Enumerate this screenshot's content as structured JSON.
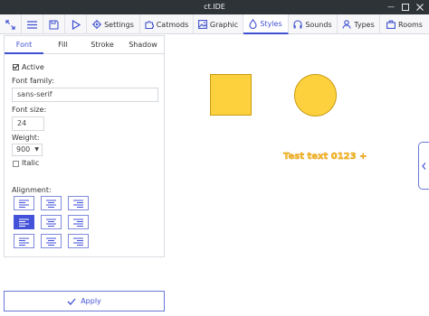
{
  "window": {
    "title": "ct.IDE"
  },
  "toolbar": {
    "tabs": [
      {
        "label": "Settings",
        "icon": "gear-icon"
      },
      {
        "label": "Catmods",
        "icon": "puzzle-icon"
      },
      {
        "label": "Graphic",
        "icon": "image-icon"
      },
      {
        "label": "Styles",
        "icon": "droplet-icon",
        "active": true
      },
      {
        "label": "Sounds",
        "icon": "headphones-icon"
      },
      {
        "label": "Types",
        "icon": "user-icon"
      },
      {
        "label": "Rooms",
        "icon": "briefcase-icon"
      }
    ]
  },
  "style_editor": {
    "subtabs": [
      "Font",
      "Fill",
      "Stroke",
      "Shadow"
    ],
    "active_subtab": "Font",
    "active_label": "Active",
    "active_checked": true,
    "font_family_label": "Font family:",
    "font_family_value": "sans-serif",
    "font_size_label": "Font size:",
    "font_size_value": "24",
    "weight_label": "Weight:",
    "weight_value": "900",
    "italic_label": "Italic",
    "italic_checked": false,
    "alignment_label": "Alignment:",
    "selected_alignment": "middle-left",
    "apply_label": "Apply"
  },
  "preview": {
    "test_text": "Test text 0123 +",
    "accent_color": "#fdd13e"
  },
  "colors": {
    "accent": "#3f51d1",
    "titlebar": "#2e3338"
  }
}
